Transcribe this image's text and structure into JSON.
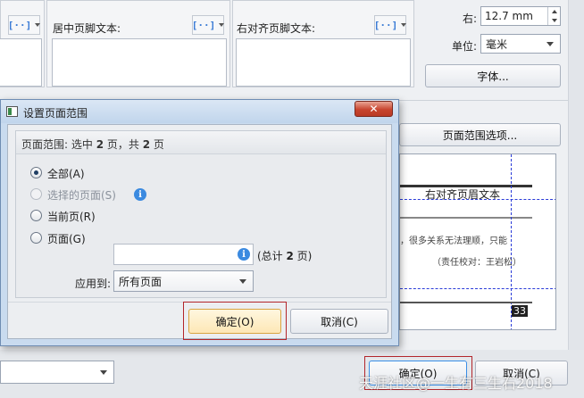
{
  "background": {
    "center_footer_label": "居中页脚文本:",
    "right_footer_label": "右对齐页脚文本:",
    "field_button_glyph": "[··]",
    "right_margin_label": "右:",
    "right_margin_value": "12.7 mm",
    "unit_label": "单位:",
    "unit_value": "毫米",
    "font_button": "字体...",
    "page_range_options_button": "页面范围选项...",
    "preview_header_text": "右对齐页眉文本",
    "preview_body_text": "，很多关系无法理顺，只能",
    "preview_credit_text": "（责任校对：王岩松）",
    "preview_page_number": "33",
    "ok_button": "确定(O)",
    "cancel_button": "取消(C)"
  },
  "dialog": {
    "title": "设置页面范围",
    "close_glyph": "✕",
    "summary_prefix": "页面范围: 选中 ",
    "summary_count": "2",
    "summary_mid": " 页，共 ",
    "summary_total": "2",
    "summary_suffix": " 页",
    "options": {
      "all": "全部(A)",
      "selected": "选择的页面(S)",
      "current": "当前页(R)",
      "pages": "页面(G)"
    },
    "pages_input_value": "",
    "total_prefix": "(总计 ",
    "total_count": "2",
    "total_suffix": " 页)",
    "apply_to_label": "应用到:",
    "apply_to_value": "所有页面",
    "ok_button": "确定(O)",
    "cancel_button": "取消(C)"
  },
  "watermark": "天涯社区@一生有三生石2018",
  "colors": {
    "dialog_frame": "#c9dbef",
    "close_button": "#c8452f",
    "highlight_box": "#b3262b",
    "info_icon": "#3b8ae0",
    "preview_guides": "#2a3bd8"
  }
}
